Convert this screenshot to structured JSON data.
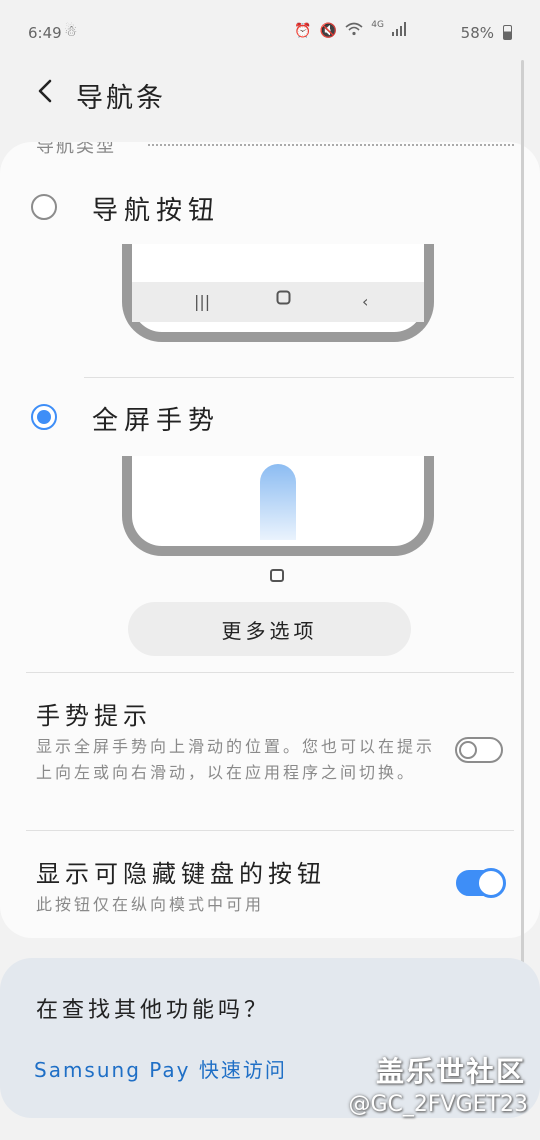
{
  "status_bar": {
    "time": "6:49",
    "network": "4G",
    "battery": "58%",
    "icons": [
      "alarm-icon",
      "mute-icon",
      "wifi-icon",
      "signal-icon"
    ]
  },
  "header": {
    "title": "导航条"
  },
  "nav_type": {
    "section_label": "导航类型",
    "options": [
      {
        "label": "导航按钮",
        "selected": false
      },
      {
        "label": "全屏手势",
        "selected": true
      }
    ],
    "more_options_label": "更多选项"
  },
  "settings": [
    {
      "title": "手势提示",
      "description": "显示全屏手势向上滑动的位置。您也可以在提示上向左或向右滑动，以在应用程序之间切换。",
      "enabled": false
    },
    {
      "title": "显示可隐藏键盘的按钮",
      "description": "此按钮仅在纵向模式中可用",
      "enabled": true
    }
  ],
  "suggestion_card": {
    "title": "在查找其他功能吗？",
    "link": "Samsung Pay 快速访问"
  },
  "watermark": {
    "line1": "盖乐世社区",
    "line2": "@GC_2FVGET23"
  },
  "colors": {
    "accent": "#3e8ef7",
    "link": "#1f6fc6"
  }
}
